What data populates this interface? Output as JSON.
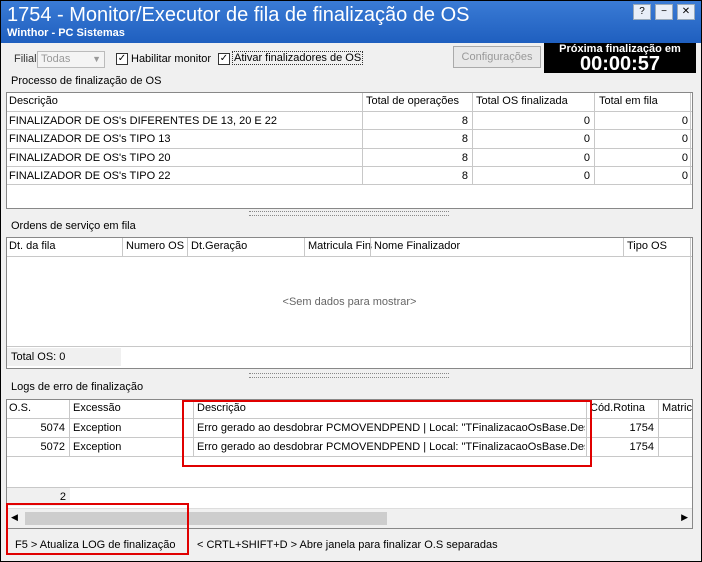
{
  "window": {
    "title": "1754 - Monitor/Executor de fila de finalização de OS",
    "subtitle": "Winthor - PC Sistemas",
    "buttons": [
      "?",
      "−",
      "✕"
    ]
  },
  "toolbar": {
    "filial_label": "Filial",
    "filial_value": "Todas",
    "habilitar_label": "Habilitar monitor",
    "habilitar_checked": true,
    "ativar_label": "Ativar finalizadores de OS",
    "ativar_checked": true,
    "config_label": "Configurações",
    "timer_label": "Próxima finalização em",
    "timer_value": "00:00:57"
  },
  "processo": {
    "title": "Processo de finalização de OS",
    "columns": [
      "Descrição",
      "Total de operações",
      "Total OS finalizada",
      "Total em fila"
    ],
    "rows": [
      [
        "FINALIZADOR DE OS's DIFERENTES DE 13, 20 E 22",
        "8",
        "0",
        "0"
      ],
      [
        "FINALIZADOR DE OS's TIPO 13",
        "8",
        "0",
        "0"
      ],
      [
        "FINALIZADOR DE OS's TIPO 20",
        "8",
        "0",
        "0"
      ],
      [
        "FINALIZADOR DE OS's TIPO 22",
        "8",
        "0",
        "0"
      ]
    ]
  },
  "ordens": {
    "title": "Ordens de serviço em fila",
    "columns": [
      "Dt. da fila",
      "Numero OS",
      "Dt.Geração",
      "Matricula Fina",
      "Nome Finalizador",
      "Tipo OS"
    ],
    "empty_text": "<Sem dados para mostrar>",
    "total_label": "Total OS: 0"
  },
  "logs": {
    "title": "Logs de erro de finalização",
    "columns": [
      "O.S.",
      "Excessão",
      "Descrição",
      "Cód.Rotina",
      "Matric"
    ],
    "rows": [
      [
        "5074",
        "Exception",
        "Erro gerado ao desdobrar PCMOVENDPEND | Local: \"TFinalizacaoOsBase.Desdob",
        "1754"
      ],
      [
        "5072",
        "Exception",
        "Erro gerado ao desdobrar PCMOVENDPEND | Local: \"TFinalizacaoOsBase.Desdob",
        "1754"
      ]
    ],
    "count": "2"
  },
  "statusbar": {
    "f5": "F5 > Atualiza LOG de finalização",
    "shortcut": "< CRTL+SHIFT+D > Abre janela para finalizar O.S separadas"
  },
  "colors": {
    "title_bar": "#1f5fbf",
    "highlight": "#e00000",
    "timer_bg": "#000000"
  }
}
